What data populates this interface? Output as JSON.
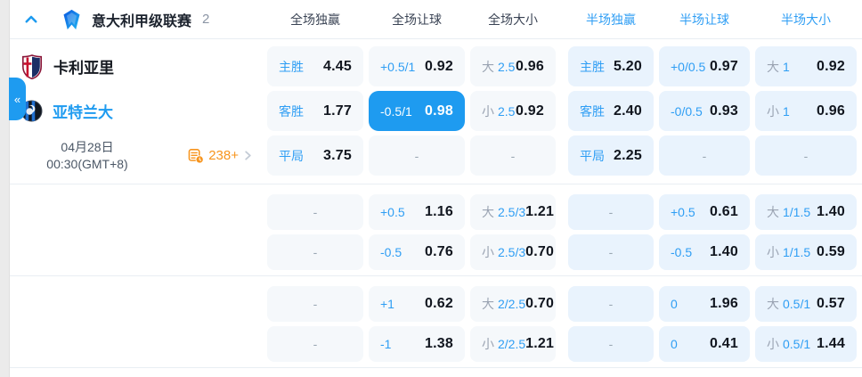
{
  "header": {
    "league": "意大利甲级联赛",
    "count": "2",
    "columns": [
      {
        "label": "全场独赢"
      },
      {
        "label": "全场让球"
      },
      {
        "label": "全场大小"
      },
      {
        "label": "半场独赢"
      },
      {
        "label": "半场让球"
      },
      {
        "label": "半场大小"
      }
    ]
  },
  "match": {
    "home_team": "卡利亚里",
    "away_team": "亚特兰大",
    "date": "04月28日",
    "time": "00:30(GMT+8)",
    "markets_count": "238+"
  },
  "sidebar": {
    "collapse_glyph": "«"
  },
  "colors": {
    "accent_blue": "#1e9bf0",
    "label_blue": "#2f9ef4",
    "half_cell_bg": "#e9f3fd",
    "full_cell_bg": "#f5f8fb",
    "orange": "#f7941d",
    "value_dark": "#11161f"
  },
  "groups": [
    {
      "rows": [
        {
          "cells": [
            {
              "label": "主胜",
              "value": "4.45"
            },
            {
              "label": "+0.5/1",
              "value": "0.92"
            },
            {
              "prefix": "大",
              "line": "2.5",
              "value": "0.96"
            },
            {
              "label": "主胜",
              "value": "5.20"
            },
            {
              "label": "+0/0.5",
              "value": "0.97"
            },
            {
              "prefix": "大",
              "line": "1",
              "value": "0.92"
            }
          ]
        },
        {
          "cells": [
            {
              "label": "客胜",
              "value": "1.77"
            },
            {
              "label": "-0.5/1",
              "value": "0.98",
              "selected": true
            },
            {
              "prefix": "小",
              "line": "2.5",
              "value": "0.92"
            },
            {
              "label": "客胜",
              "value": "2.40"
            },
            {
              "label": "-0/0.5",
              "value": "0.93"
            },
            {
              "prefix": "小",
              "line": "1",
              "value": "0.96"
            }
          ]
        },
        {
          "cells": [
            {
              "label": "平局",
              "value": "3.75"
            },
            {
              "dash": true
            },
            {
              "dash": true
            },
            {
              "label": "平局",
              "value": "2.25"
            },
            {
              "dash": true
            },
            {
              "dash": true
            }
          ]
        }
      ]
    },
    {
      "rows": [
        {
          "cells": [
            {
              "dash": true
            },
            {
              "label": "+0.5",
              "value": "1.16"
            },
            {
              "prefix": "大",
              "line": "2.5/3",
              "value": "1.21"
            },
            {
              "dash": true
            },
            {
              "label": "+0.5",
              "value": "0.61"
            },
            {
              "prefix": "大",
              "line": "1/1.5",
              "value": "1.40"
            }
          ]
        },
        {
          "cells": [
            {
              "dash": true
            },
            {
              "label": "-0.5",
              "value": "0.76"
            },
            {
              "prefix": "小",
              "line": "2.5/3",
              "value": "0.70"
            },
            {
              "dash": true
            },
            {
              "label": "-0.5",
              "value": "1.40"
            },
            {
              "prefix": "小",
              "line": "1/1.5",
              "value": "0.59"
            }
          ]
        }
      ]
    },
    {
      "rows": [
        {
          "cells": [
            {
              "dash": true
            },
            {
              "label": "+1",
              "value": "0.62"
            },
            {
              "prefix": "大",
              "line": "2/2.5",
              "value": "0.70"
            },
            {
              "dash": true
            },
            {
              "label": "0",
              "value": "1.96"
            },
            {
              "prefix": "大",
              "line": "0.5/1",
              "value": "0.57"
            }
          ]
        },
        {
          "cells": [
            {
              "dash": true
            },
            {
              "label": "-1",
              "value": "1.38"
            },
            {
              "prefix": "小",
              "line": "2/2.5",
              "value": "1.21"
            },
            {
              "dash": true
            },
            {
              "label": "0",
              "value": "0.41"
            },
            {
              "prefix": "小",
              "line": "0.5/1",
              "value": "1.44"
            }
          ]
        }
      ]
    }
  ]
}
